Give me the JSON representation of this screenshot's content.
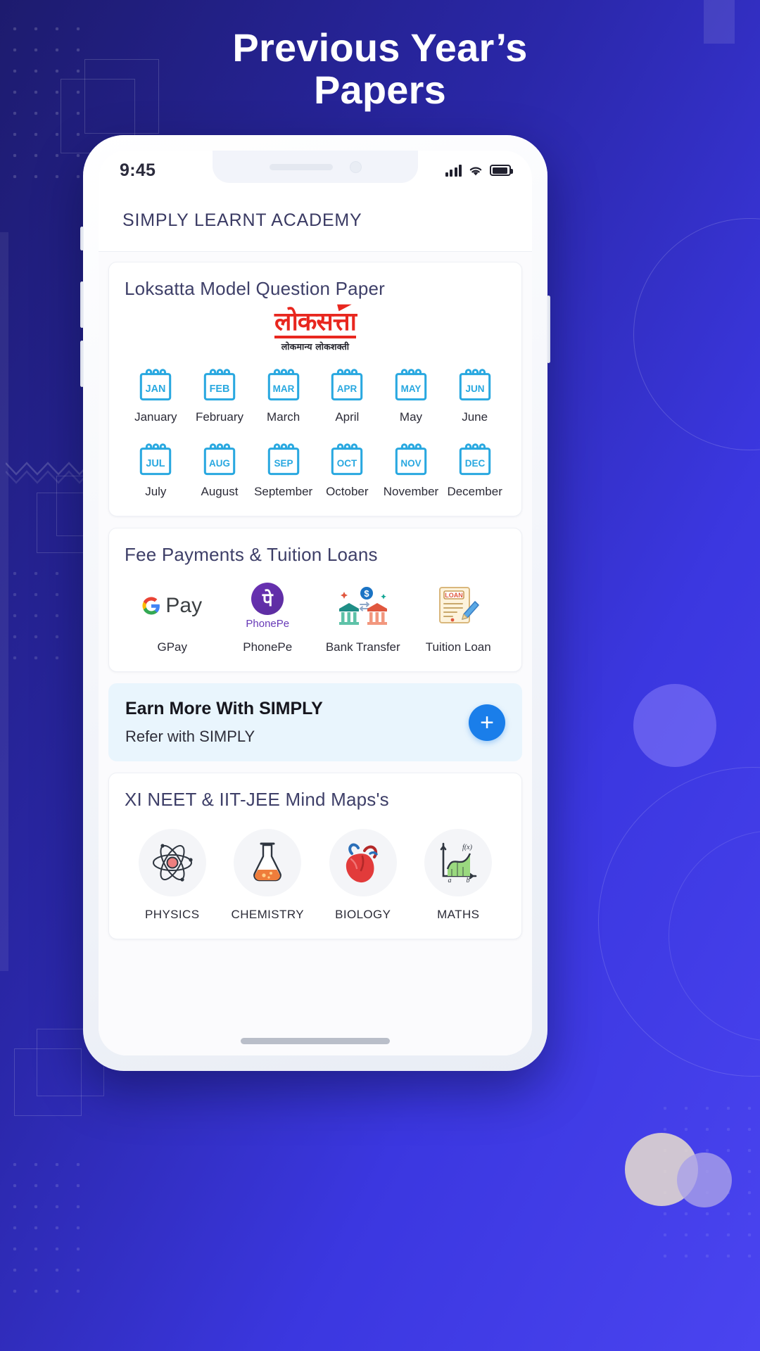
{
  "hero": {
    "line1": "Previous Year’s",
    "line2": "Papers"
  },
  "phone": {
    "status": {
      "time": "9:45",
      "signal_icon": "signal-bars-icon",
      "wifi_icon": "wifi-icon",
      "battery_icon": "battery-icon"
    }
  },
  "app": {
    "title": "SIMPLY LEARNT ACADEMY"
  },
  "papers_card": {
    "title": "Loksatta Model Question Paper",
    "logo": {
      "main": "लोकसत्ता",
      "sub": "लोकमान्य लोकशक्ती"
    },
    "months": [
      {
        "abbr": "JAN",
        "label": "January"
      },
      {
        "abbr": "FEB",
        "label": "February"
      },
      {
        "abbr": "MAR",
        "label": "March"
      },
      {
        "abbr": "APR",
        "label": "April"
      },
      {
        "abbr": "MAY",
        "label": "May"
      },
      {
        "abbr": "JUN",
        "label": "June"
      },
      {
        "abbr": "JUL",
        "label": "July"
      },
      {
        "abbr": "AUG",
        "label": "August"
      },
      {
        "abbr": "SEP",
        "label": "September"
      },
      {
        "abbr": "OCT",
        "label": "October"
      },
      {
        "abbr": "NOV",
        "label": "November"
      },
      {
        "abbr": "DEC",
        "label": "December"
      }
    ]
  },
  "payments_card": {
    "title": "Fee Payments & Tuition Loans",
    "methods": [
      {
        "label": "GPay",
        "icon": "google-pay-icon",
        "brand_text": "Pay"
      },
      {
        "label": "PhonePe",
        "icon": "phonepe-icon",
        "brand_text": "PhonePe",
        "glyph": "पे"
      },
      {
        "label": "Bank Transfer",
        "icon": "bank-transfer-icon"
      },
      {
        "label": "Tuition Loan",
        "icon": "loan-document-icon",
        "doc_text": "LOAN"
      }
    ]
  },
  "referral": {
    "title": "Earn More With SIMPLY",
    "subtitle": "Refer with SIMPLY",
    "action_icon": "plus-icon",
    "action_label": "+"
  },
  "mindmaps_card": {
    "title": "XI NEET & IIT-JEE Mind Maps's",
    "subjects": [
      {
        "label": "PHYSICS",
        "icon": "atom-icon"
      },
      {
        "label": "CHEMISTRY",
        "icon": "flask-icon"
      },
      {
        "label": "BIOLOGY",
        "icon": "heart-anatomy-icon"
      },
      {
        "label": "MATHS",
        "icon": "integral-graph-icon",
        "glyph": "f(x)"
      }
    ]
  },
  "colors": {
    "bg_gradient_start": "#1d1b6e",
    "bg_gradient_end": "#4a44f0",
    "calendar_icon": "#29a8e0",
    "accent_blue": "#1a7eea",
    "banner_bg": "#e9f5fd",
    "loksatta_red": "#e8271f",
    "card_title": "#3e3f68"
  }
}
